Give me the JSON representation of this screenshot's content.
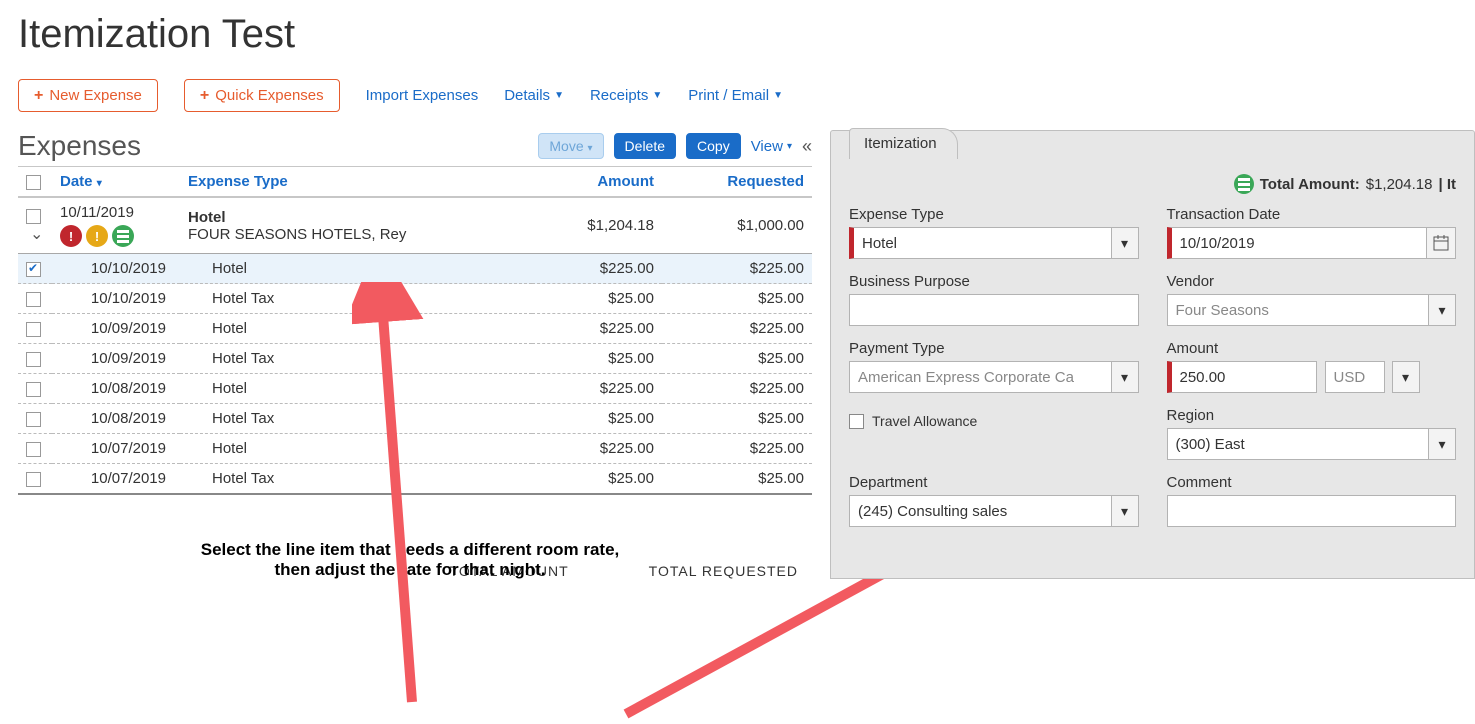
{
  "page_title": "Itemization Test",
  "toolbar": {
    "new_expense": "New Expense",
    "quick_expenses": "Quick Expenses",
    "import_expenses": "Import Expenses",
    "details": "Details",
    "receipts": "Receipts",
    "print_email": "Print / Email"
  },
  "expenses_section": {
    "title": "Expenses",
    "actions": {
      "move": "Move",
      "delete": "Delete",
      "copy": "Copy",
      "view": "View"
    },
    "columns": {
      "date": "Date",
      "expense_type": "Expense Type",
      "amount": "Amount",
      "requested": "Requested"
    },
    "parent": {
      "date": "10/11/2019",
      "expense_type": "Hotel",
      "vendor_sub": "FOUR SEASONS HOTELS, Rey",
      "amount": "$1,204.18",
      "requested": "$1,000.00"
    },
    "rows": [
      {
        "date": "10/10/2019",
        "type": "Hotel",
        "amount": "$225.00",
        "requested": "$225.00",
        "selected": true
      },
      {
        "date": "10/10/2019",
        "type": "Hotel Tax",
        "amount": "$25.00",
        "requested": "$25.00",
        "selected": false
      },
      {
        "date": "10/09/2019",
        "type": "Hotel",
        "amount": "$225.00",
        "requested": "$225.00",
        "selected": false
      },
      {
        "date": "10/09/2019",
        "type": "Hotel Tax",
        "amount": "$25.00",
        "requested": "$25.00",
        "selected": false
      },
      {
        "date": "10/08/2019",
        "type": "Hotel",
        "amount": "$225.00",
        "requested": "$225.00",
        "selected": false
      },
      {
        "date": "10/08/2019",
        "type": "Hotel Tax",
        "amount": "$25.00",
        "requested": "$25.00",
        "selected": false
      },
      {
        "date": "10/07/2019",
        "type": "Hotel",
        "amount": "$225.00",
        "requested": "$225.00",
        "selected": false
      },
      {
        "date": "10/07/2019",
        "type": "Hotel Tax",
        "amount": "$25.00",
        "requested": "$25.00",
        "selected": false
      }
    ],
    "footer": {
      "total_amount": "TOTAL AMOUNT",
      "total_requested": "TOTAL REQUESTED"
    }
  },
  "annotation": "Select the line item that needs a different room rate, then adjust the rate for that night.",
  "right": {
    "tab": "Itemization",
    "total_label": "Total Amount:",
    "total_value": "$1,204.18",
    "total_suffix": " | It",
    "fields": {
      "expense_type": {
        "label": "Expense Type",
        "value": "Hotel"
      },
      "transaction_date": {
        "label": "Transaction Date",
        "value": "10/10/2019"
      },
      "business_purpose": {
        "label": "Business Purpose",
        "value": ""
      },
      "vendor": {
        "label": "Vendor",
        "value": "Four Seasons"
      },
      "payment_type": {
        "label": "Payment Type",
        "value": "American Express Corporate Ca"
      },
      "amount": {
        "label": "Amount",
        "value": "250.00",
        "currency": "USD"
      },
      "travel_allowance": {
        "label": "Travel Allowance"
      },
      "region": {
        "label": "Region",
        "value": "(300) East"
      },
      "department": {
        "label": "Department",
        "value": "(245) Consulting sales"
      },
      "comment": {
        "label": "Comment",
        "value": ""
      }
    }
  }
}
